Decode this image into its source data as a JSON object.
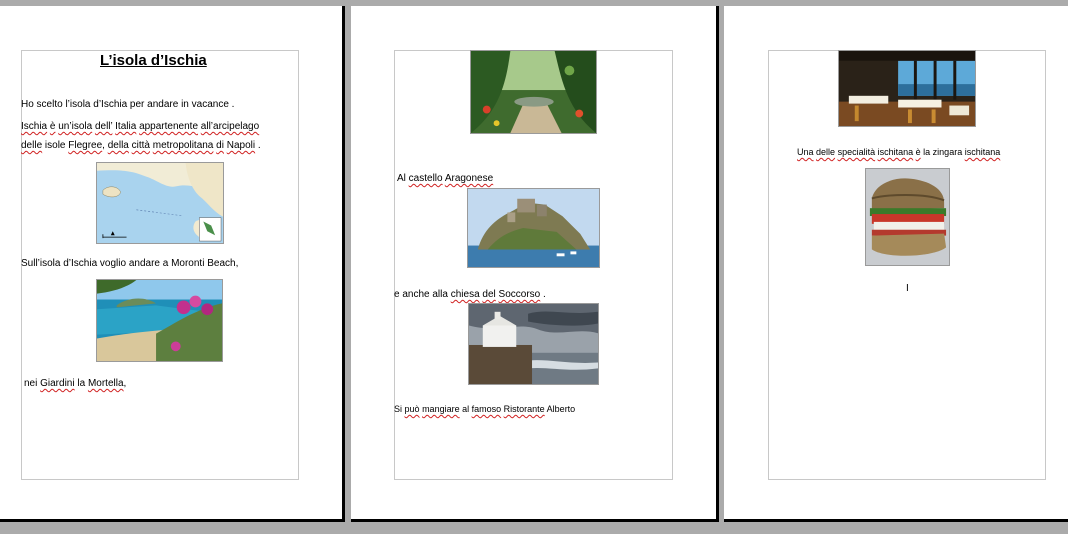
{
  "page1": {
    "title": "L’isola d’Ischia",
    "line1": "Ho scelto l’isola d’Ischia per andare in vacance .",
    "line2_parts": [
      "Ischia",
      " ",
      "è",
      " ",
      "un’isola",
      " ",
      "dell’",
      " ",
      "Italia",
      " ",
      "appartenente",
      " ",
      "all’arcipelago"
    ],
    "line3_parts": [
      "delle",
      " isole ",
      "Flegree",
      ", ",
      "della",
      " ",
      "città",
      " ",
      "metropolitana",
      " ",
      "di",
      " ",
      "Napoli",
      " ."
    ],
    "line4": "Sull’isola d’Ischia voglio andare a Moronti Beach,",
    "line5_parts": [
      "nei ",
      "Giardini",
      " la ",
      "Mortella",
      ","
    ]
  },
  "page2": {
    "line1_parts": [
      "Al ",
      "castello",
      " ",
      "Aragonese"
    ],
    "line2_parts": [
      "e anche alla ",
      "chiesa",
      " ",
      "del",
      " ",
      "Soccorso",
      " ."
    ],
    "line3_parts": [
      "Si ",
      "può",
      " ",
      "mangiare",
      " al ",
      "famoso",
      " ",
      "Ristorante",
      " Alberto"
    ]
  },
  "page3": {
    "caption_parts": [
      "Una",
      " ",
      "delle",
      " ",
      "specialità",
      " ",
      "ischitana",
      " ",
      "è",
      " la zingara ",
      "ischitana"
    ],
    "cursor_text": "I"
  },
  "colors": {
    "workspace": "#ababab",
    "page": "#ffffff",
    "spellcheck": "#d02020"
  },
  "icons": {
    "map": "map-of-ischia-image",
    "beach": "moronti-beach-photo",
    "garden": "giardini-mortella-photo",
    "castle": "castello-aragonese-photo",
    "church": "chiesa-soccorso-photo",
    "restaurant": "ristorante-alberto-photo",
    "sandwich": "zingara-ischitana-photo"
  }
}
